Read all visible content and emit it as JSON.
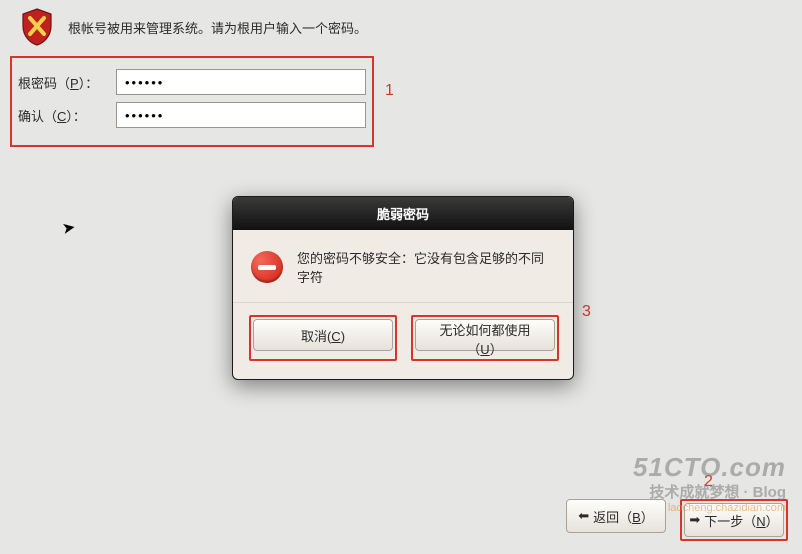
{
  "header": {
    "description": "根帐号被用来管理系统。请为根用户输入一个密码。"
  },
  "password_fields": {
    "root_label_pre": "根密码（",
    "root_accel": "P",
    "root_label_post": "）：",
    "confirm_label_pre": "确认（",
    "confirm_accel": "C",
    "confirm_label_post": "）：",
    "root_value": "••••••",
    "confirm_value": "••••••"
  },
  "annotations": {
    "one": "1",
    "two": "2",
    "three": "3"
  },
  "dialog": {
    "title": "脆弱密码",
    "message": "您的密码不够安全：它没有包含足够的不同字符",
    "cancel_pre": "取消(",
    "cancel_accel": "C",
    "cancel_post": ")",
    "use_pre": "无论如何都使用（",
    "use_accel": "U",
    "use_post": "）"
  },
  "nav": {
    "back_pre": "返回（",
    "back_accel": "B",
    "back_post": "）",
    "next_pre": "下一步（",
    "next_accel": "N",
    "next_post": "）"
  },
  "watermark": {
    "line1": "51CTO.com",
    "line2": "技术成就梦想 · Blog",
    "line3": "laocheng.chazidian.com"
  },
  "icons": {
    "arrow_left": "⬅",
    "arrow_right": "➡"
  }
}
